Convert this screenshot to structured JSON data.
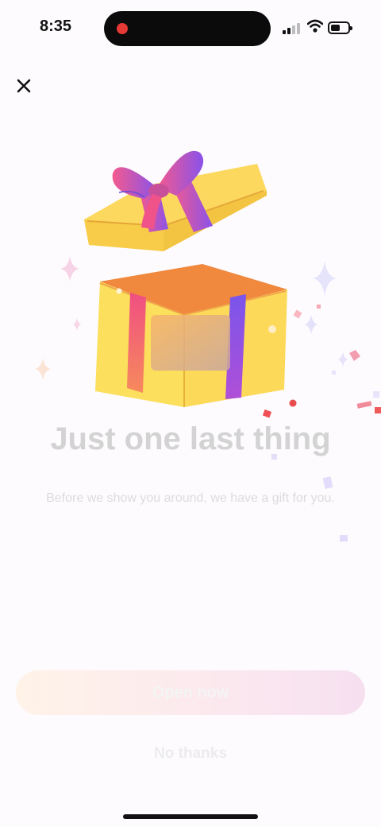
{
  "status": {
    "time": "8:35"
  },
  "close": {
    "icon": "close-icon"
  },
  "hero": {
    "title": "Just one last thing",
    "subtitle": "Before we show you around, we have a gift for you."
  },
  "actions": {
    "primary_label": "Open now",
    "secondary_label": "No thanks"
  },
  "colors": {
    "gift_yellow": "#fcdc5c",
    "gift_orange": "#ef8a3c",
    "ribbon_pink": "#f0528c",
    "ribbon_purple": "#8a4fe8"
  }
}
